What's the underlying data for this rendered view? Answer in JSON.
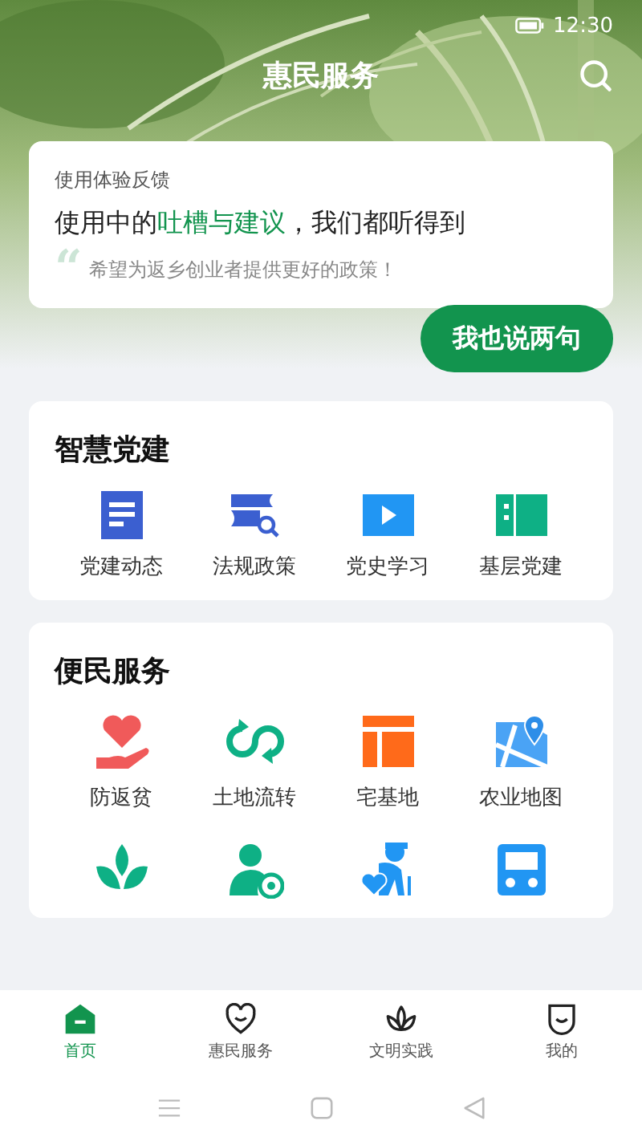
{
  "status_bar": {
    "time": "12:30"
  },
  "header": {
    "title": "惠民服务"
  },
  "feedback": {
    "caption": "使用体验反馈",
    "headline": "使用中的**吐槽与建议**，我们都听得到",
    "quote_mark": "“",
    "quote": "希望为返乡创业者提供更好的政策！",
    "button": "我也说两句"
  },
  "party_section": {
    "title": "智慧党建",
    "items": [
      {
        "label": "党建动态"
      },
      {
        "label": "法规政策"
      },
      {
        "label": "党史学习"
      },
      {
        "label": "基层党建"
      }
    ]
  },
  "service_section": {
    "title": "便民服务",
    "items": [
      {
        "label": "防返贫"
      },
      {
        "label": "土地流转"
      },
      {
        "label": "宅基地"
      },
      {
        "label": "农业地图"
      }
    ]
  },
  "tabs": [
    {
      "label": "首页",
      "selected": true
    },
    {
      "label": "惠民服务",
      "selected": false
    },
    {
      "label": "文明实践",
      "selected": false
    },
    {
      "label": "我的",
      "selected": false
    }
  ]
}
